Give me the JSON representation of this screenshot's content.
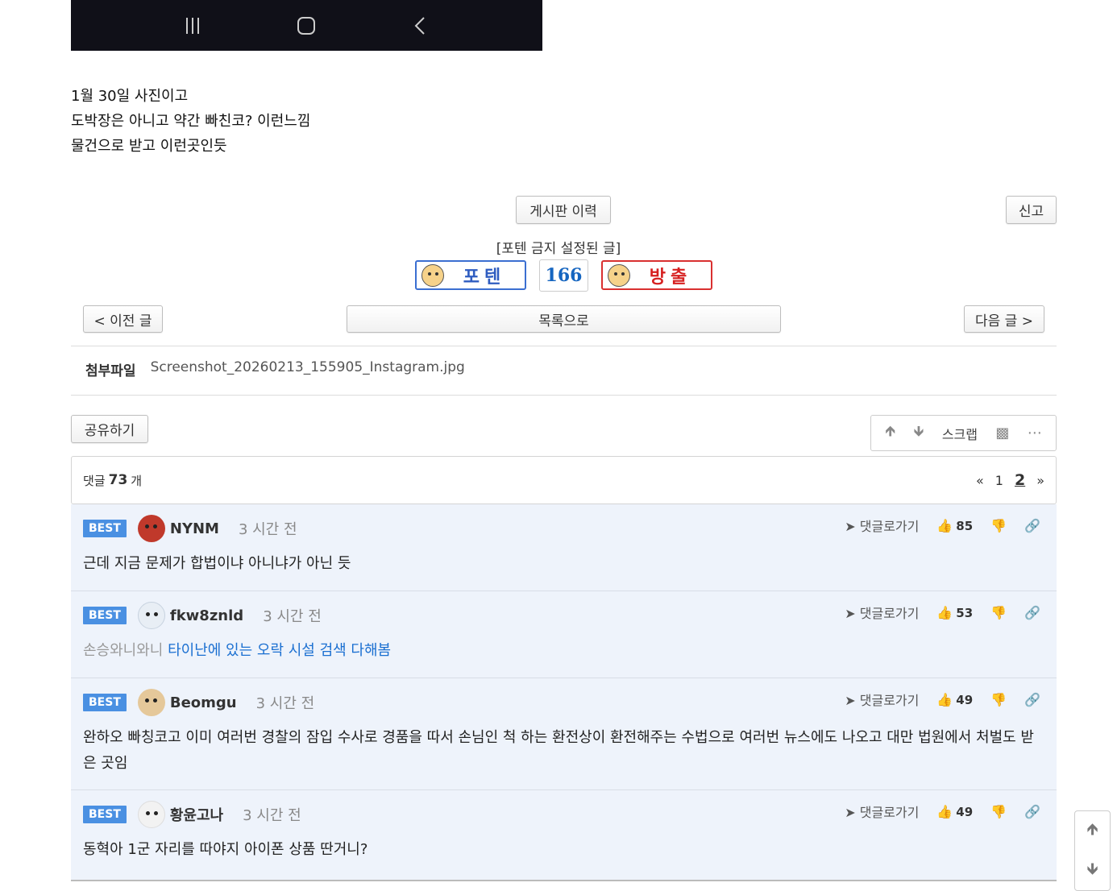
{
  "post": {
    "lines": [
      "1월 30일 사진이고",
      "도박장은 아니고 약간 빠친코? 이런느낌",
      "물건으로 받고 이런곳인듯"
    ]
  },
  "buttons": {
    "board_history": "게시판 이력",
    "report": "신고",
    "prev": "< 이전 글",
    "list": "목록으로",
    "next": "다음 글 >",
    "share": "공유하기"
  },
  "vote": {
    "notice": "[포텐 금지 설정된 글]",
    "up_label": "포텐",
    "count": "166",
    "down_label": "방출"
  },
  "attachment": {
    "label": "첨부파일",
    "filename": "Screenshot_20260213_155905_Instagram.jpg"
  },
  "toolbox": {
    "scrap": "스크랩"
  },
  "comments_header": {
    "prefix": "댓글",
    "count": "73",
    "suffix": "개",
    "pages": [
      "1",
      "2"
    ],
    "current_page": "2"
  },
  "comment_ui": {
    "best": "BEST",
    "goto": "댓글로가기"
  },
  "comments": [
    {
      "nick": "NYNM",
      "time": "3 시간 전",
      "likes": "85",
      "text": "근데 지금 문제가 합법이냐 아니냐가 아닌 듯",
      "avatar_color": "#c0392b"
    },
    {
      "nick": "fkw8znld",
      "time": "3 시간 전",
      "likes": "53",
      "text_gray": "손승와니와니",
      "text_blue": "타이난에 있는 오락 시설 검색 다해봄",
      "avatar_color": "#e8eef5"
    },
    {
      "nick": "Beomgu",
      "time": "3 시간 전",
      "likes": "49",
      "text": "완하오 빠칭코고 이미 여러번 경찰의 잠입 수사로 경품을 따서 손님인 척 하는 환전상이 환전해주는 수법으로 여러번 뉴스에도 나오고 대만 법원에서 처벌도 받은 곳임",
      "avatar_color": "#e5c89a"
    },
    {
      "nick": "황윤고나",
      "time": "3 시간 전",
      "likes": "49",
      "text": "동혁아 1군 자리를 따야지 아이폰 상품 딴거니?",
      "avatar_color": "#f2f2f2"
    }
  ]
}
